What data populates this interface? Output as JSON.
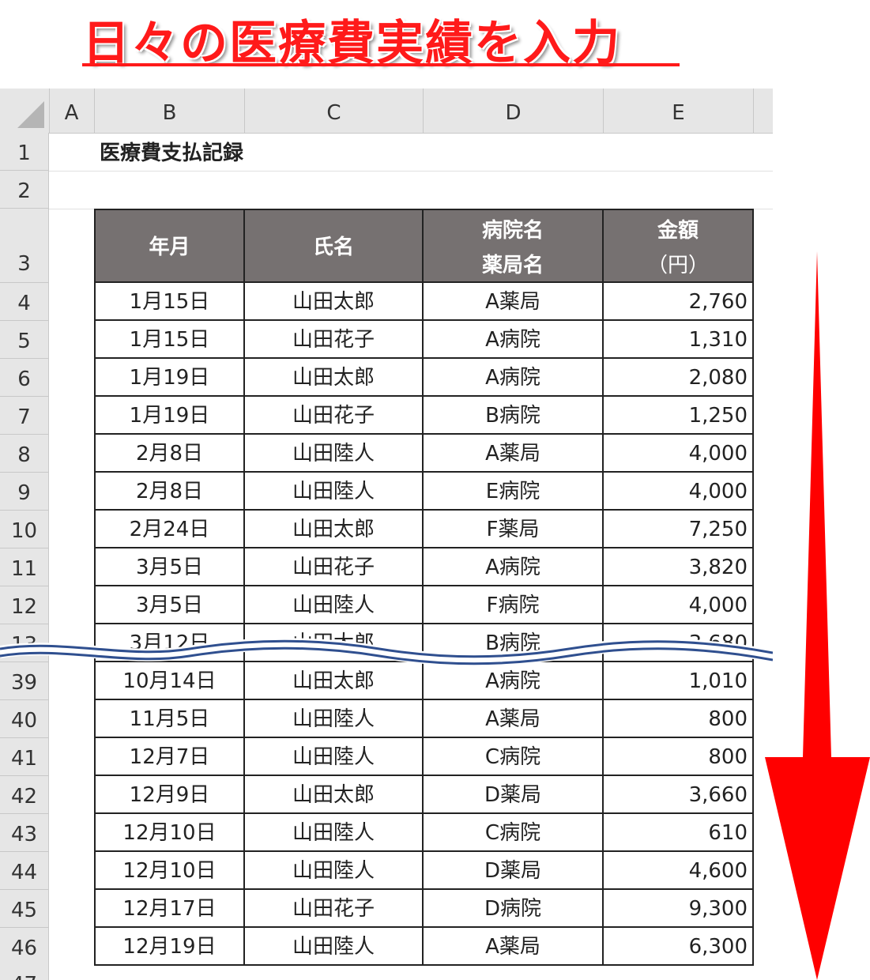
{
  "banner": {
    "title": "日々の医療費実績を入力"
  },
  "sheet": {
    "columns": [
      "A",
      "B",
      "C",
      "D",
      "E"
    ],
    "title": "医療費支払記録",
    "headers": {
      "date": "年月",
      "name": "氏名",
      "place_line1": "病院名",
      "place_line2": "薬局名",
      "amount_line1": "金額",
      "amount_line2": "（円）"
    },
    "header_rows": [
      "1",
      "2",
      "3"
    ],
    "rows": [
      {
        "row": "4",
        "date": "1月15日",
        "name": "山田太郎",
        "place": "A薬局",
        "amount": "2,760"
      },
      {
        "row": "5",
        "date": "1月15日",
        "name": "山田花子",
        "place": "A病院",
        "amount": "1,310"
      },
      {
        "row": "6",
        "date": "1月19日",
        "name": "山田太郎",
        "place": "A病院",
        "amount": "2,080"
      },
      {
        "row": "7",
        "date": "1月19日",
        "name": "山田花子",
        "place": "B病院",
        "amount": "1,250"
      },
      {
        "row": "8",
        "date": "2月8日",
        "name": "山田陸人",
        "place": "A薬局",
        "amount": "4,000"
      },
      {
        "row": "9",
        "date": "2月8日",
        "name": "山田陸人",
        "place": "E病院",
        "amount": "4,000"
      },
      {
        "row": "10",
        "date": "2月24日",
        "name": "山田太郎",
        "place": "F薬局",
        "amount": "7,250"
      },
      {
        "row": "11",
        "date": "3月5日",
        "name": "山田花子",
        "place": "A病院",
        "amount": "3,820"
      },
      {
        "row": "12",
        "date": "3月5日",
        "name": "山田陸人",
        "place": "F病院",
        "amount": "4,000"
      },
      {
        "row": "13",
        "date": "3月12日",
        "name": "山田太郎",
        "place": "B病院",
        "amount": "3,680"
      },
      {
        "row": "39",
        "date": "10月14日",
        "name": "山田太郎",
        "place": "A病院",
        "amount": "1,010"
      },
      {
        "row": "40",
        "date": "11月5日",
        "name": "山田陸人",
        "place": "A薬局",
        "amount": "800"
      },
      {
        "row": "41",
        "date": "12月7日",
        "name": "山田陸人",
        "place": "C病院",
        "amount": "800"
      },
      {
        "row": "42",
        "date": "12月9日",
        "name": "山田太郎",
        "place": "D薬局",
        "amount": "3,660"
      },
      {
        "row": "43",
        "date": "12月10日",
        "name": "山田陸人",
        "place": "C病院",
        "amount": "610"
      },
      {
        "row": "44",
        "date": "12月10日",
        "name": "山田陸人",
        "place": "D薬局",
        "amount": "4,600"
      },
      {
        "row": "45",
        "date": "12月17日",
        "name": "山田花子",
        "place": "D病院",
        "amount": "9,300"
      },
      {
        "row": "46",
        "date": "12月19日",
        "name": "山田陸人",
        "place": "A薬局",
        "amount": "6,300"
      }
    ],
    "last_row_partial": "47"
  },
  "colors": {
    "banner_red": "#ff1a1a",
    "header_fill": "#767171",
    "wave": "#2f4f8f",
    "arrow": "#ff0000"
  },
  "icons": [
    "select-all-triangle-icon",
    "down-arrow-icon",
    "wavy-break-icon"
  ]
}
